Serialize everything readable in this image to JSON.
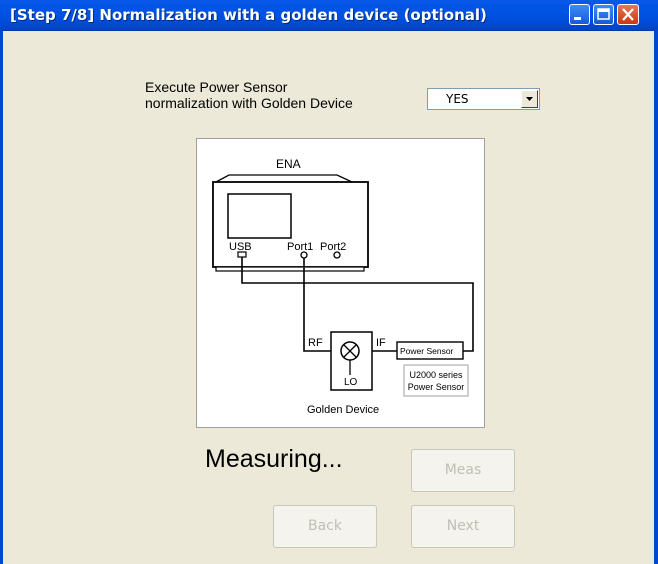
{
  "window": {
    "title": "[Step 7/8] Normalization with a golden device (optional)",
    "controls": [
      "minimize-icon",
      "maximize-icon",
      "close-icon"
    ]
  },
  "option": {
    "label_line1": "Execute Power Sensor",
    "label_line2": "normalization with Golden Device",
    "selected": "YES"
  },
  "diagram": {
    "instrument": "ENA",
    "usb": "USB",
    "port1": "Port1",
    "port2": "Port2",
    "rf": "RF",
    "if": "IF",
    "lo": "LO",
    "power_sensor": "Power Sensor",
    "sensor_series_line1": "U2000 series",
    "sensor_series_line2": "Power Sensor",
    "golden_device": "Golden Device"
  },
  "status": "Measuring...",
  "buttons": {
    "meas": "Meas",
    "back": "Back",
    "next": "Next"
  },
  "colors": {
    "titlebar": "#0055e5",
    "dialog_bg": "#ece9d8",
    "disabled_text": "#c0bfb5"
  }
}
